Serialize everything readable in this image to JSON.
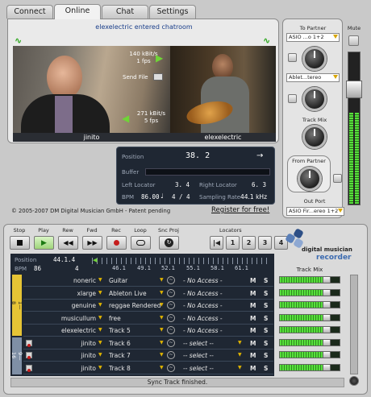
{
  "tabs": [
    "Connect",
    "Online",
    "Chat",
    "Settings"
  ],
  "chat": {
    "status": "elexelectric entered chatroom",
    "send_rate": "140 kBit/s",
    "send_fps": "1 fps",
    "send_file": "Send File",
    "recv_rate": "271 kBit/s",
    "recv_fps": "5 fps",
    "user_left": "jinito",
    "user_right": "elexelectric"
  },
  "transport_info": {
    "position_label": "Position",
    "position_value": "38. 2",
    "buffer_label": "Buffer",
    "left_locator_label": "Left Locator",
    "left_locator_value": "3. 4",
    "right_locator_label": "Right Locator",
    "right_locator_value": "6. 3",
    "bpm_label": "BPM",
    "bpm_value": "86.00",
    "bpm_note": "♩",
    "time_sig": "4 / 4",
    "sampling_label": "Sampling Rate",
    "sampling_value": "44.1 kHz"
  },
  "footer": {
    "copyright": "© 2005-2007 DM Digital Musician GmbH - Patent pending",
    "register": "Register for free!"
  },
  "to_partner": {
    "title": "To Partner",
    "mute": "Mute",
    "asio_select": "ASIO ...o 1+2",
    "ableton_select": "Ablet...tereo",
    "track_mix": "Track Mix",
    "from_partner": "From Partner",
    "out_port": "Out Port",
    "out_select": "ASIO Fir...ereo 1+2"
  },
  "recorder": {
    "buttons": [
      "Stop",
      "Play",
      "Rew",
      "Fwd",
      "Rec",
      "Loop",
      "Snc Proj"
    ],
    "locators_label": "Locators",
    "locators": [
      "1",
      "2",
      "3",
      "4"
    ],
    "logo_top": "digital musician",
    "logo_bottom": "recorder",
    "position_label": "Position",
    "position_value": "44.1.4",
    "bpm_label": "BPM",
    "bpm_value": "86",
    "bpm_denominator": "4",
    "ruler": [
      "46.1",
      "49.1",
      "52.1",
      "55.1",
      "58.1",
      "61.1"
    ],
    "group_a": "1—8",
    "group_b": "9—16",
    "track_mix_label": "Track Mix",
    "status": "Sync Track finished."
  },
  "tracks": [
    {
      "user": "noneric",
      "name": "Guitar",
      "access": "- No Access -",
      "m": "M",
      "s": "S",
      "meter": 0.78
    },
    {
      "user": "xlarge",
      "name": "Ableton Live",
      "access": "- No Access -",
      "m": "M",
      "s": "S",
      "meter": 0.78
    },
    {
      "user": "genuine",
      "name": "reggae Rendered",
      "access": "- No Access -",
      "m": "M",
      "s": "S",
      "meter": 0.78
    },
    {
      "user": "musicullum",
      "name": "free",
      "access": "- No Access -",
      "m": "M",
      "s": "S",
      "meter": 0.78
    },
    {
      "user": "elexelectric",
      "name": "Track 5",
      "access": "- No Access -",
      "m": "M",
      "s": "S",
      "meter": 0.78
    },
    {
      "user": "jinito",
      "name": "Track 6",
      "access": "-- select --",
      "m": "M",
      "s": "S",
      "meter": 0.78
    },
    {
      "user": "jinito",
      "name": "Track 7",
      "access": "-- select --",
      "m": "M",
      "s": "S",
      "meter": 0.78
    },
    {
      "user": "jinito",
      "name": "Track 8",
      "access": "-- select --",
      "m": "M",
      "s": "S",
      "meter": 0.78
    }
  ]
}
